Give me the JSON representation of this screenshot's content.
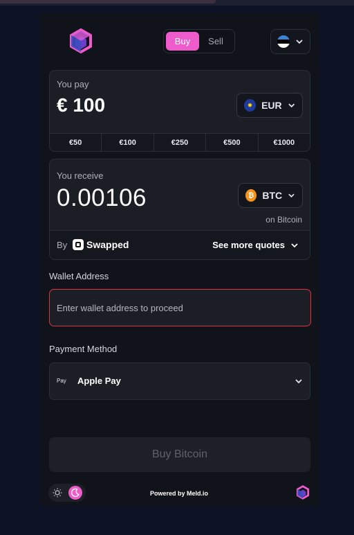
{
  "header": {
    "tabs": [
      {
        "label": "Buy",
        "active": true
      },
      {
        "label": "Sell",
        "active": false
      }
    ],
    "language_flag": "estonia-flag-icon"
  },
  "pay": {
    "label": "You pay",
    "amount": "€ 100",
    "currency": "EUR",
    "currency_icon": "eu-flag-icon",
    "presets": [
      "€50",
      "€100",
      "€250",
      "€500",
      "€1000"
    ]
  },
  "receive": {
    "label": "You receive",
    "amount": "0.00106",
    "currency": "BTC",
    "currency_icon": "bitcoin-icon",
    "network": "on Bitcoin",
    "provider_prefix": "By",
    "provider_name": "Swapped",
    "more_quotes": "See more quotes"
  },
  "wallet": {
    "label": "Wallet Address",
    "placeholder": "Enter wallet address to proceed"
  },
  "payment": {
    "label": "Payment Method",
    "icon_text": "Pay",
    "method": "Apple Pay"
  },
  "action": {
    "label": "Buy Bitcoin"
  },
  "footer": {
    "powered_by": "Powered by Meld.io"
  },
  "colors": {
    "accent": "#ee5ccb",
    "background": "#0d1224",
    "panel": "#101319",
    "card": "#1b1e25",
    "error_border": "#e0333f",
    "bitcoin": "#f7931a",
    "eu_blue": "#1e3a9c"
  }
}
